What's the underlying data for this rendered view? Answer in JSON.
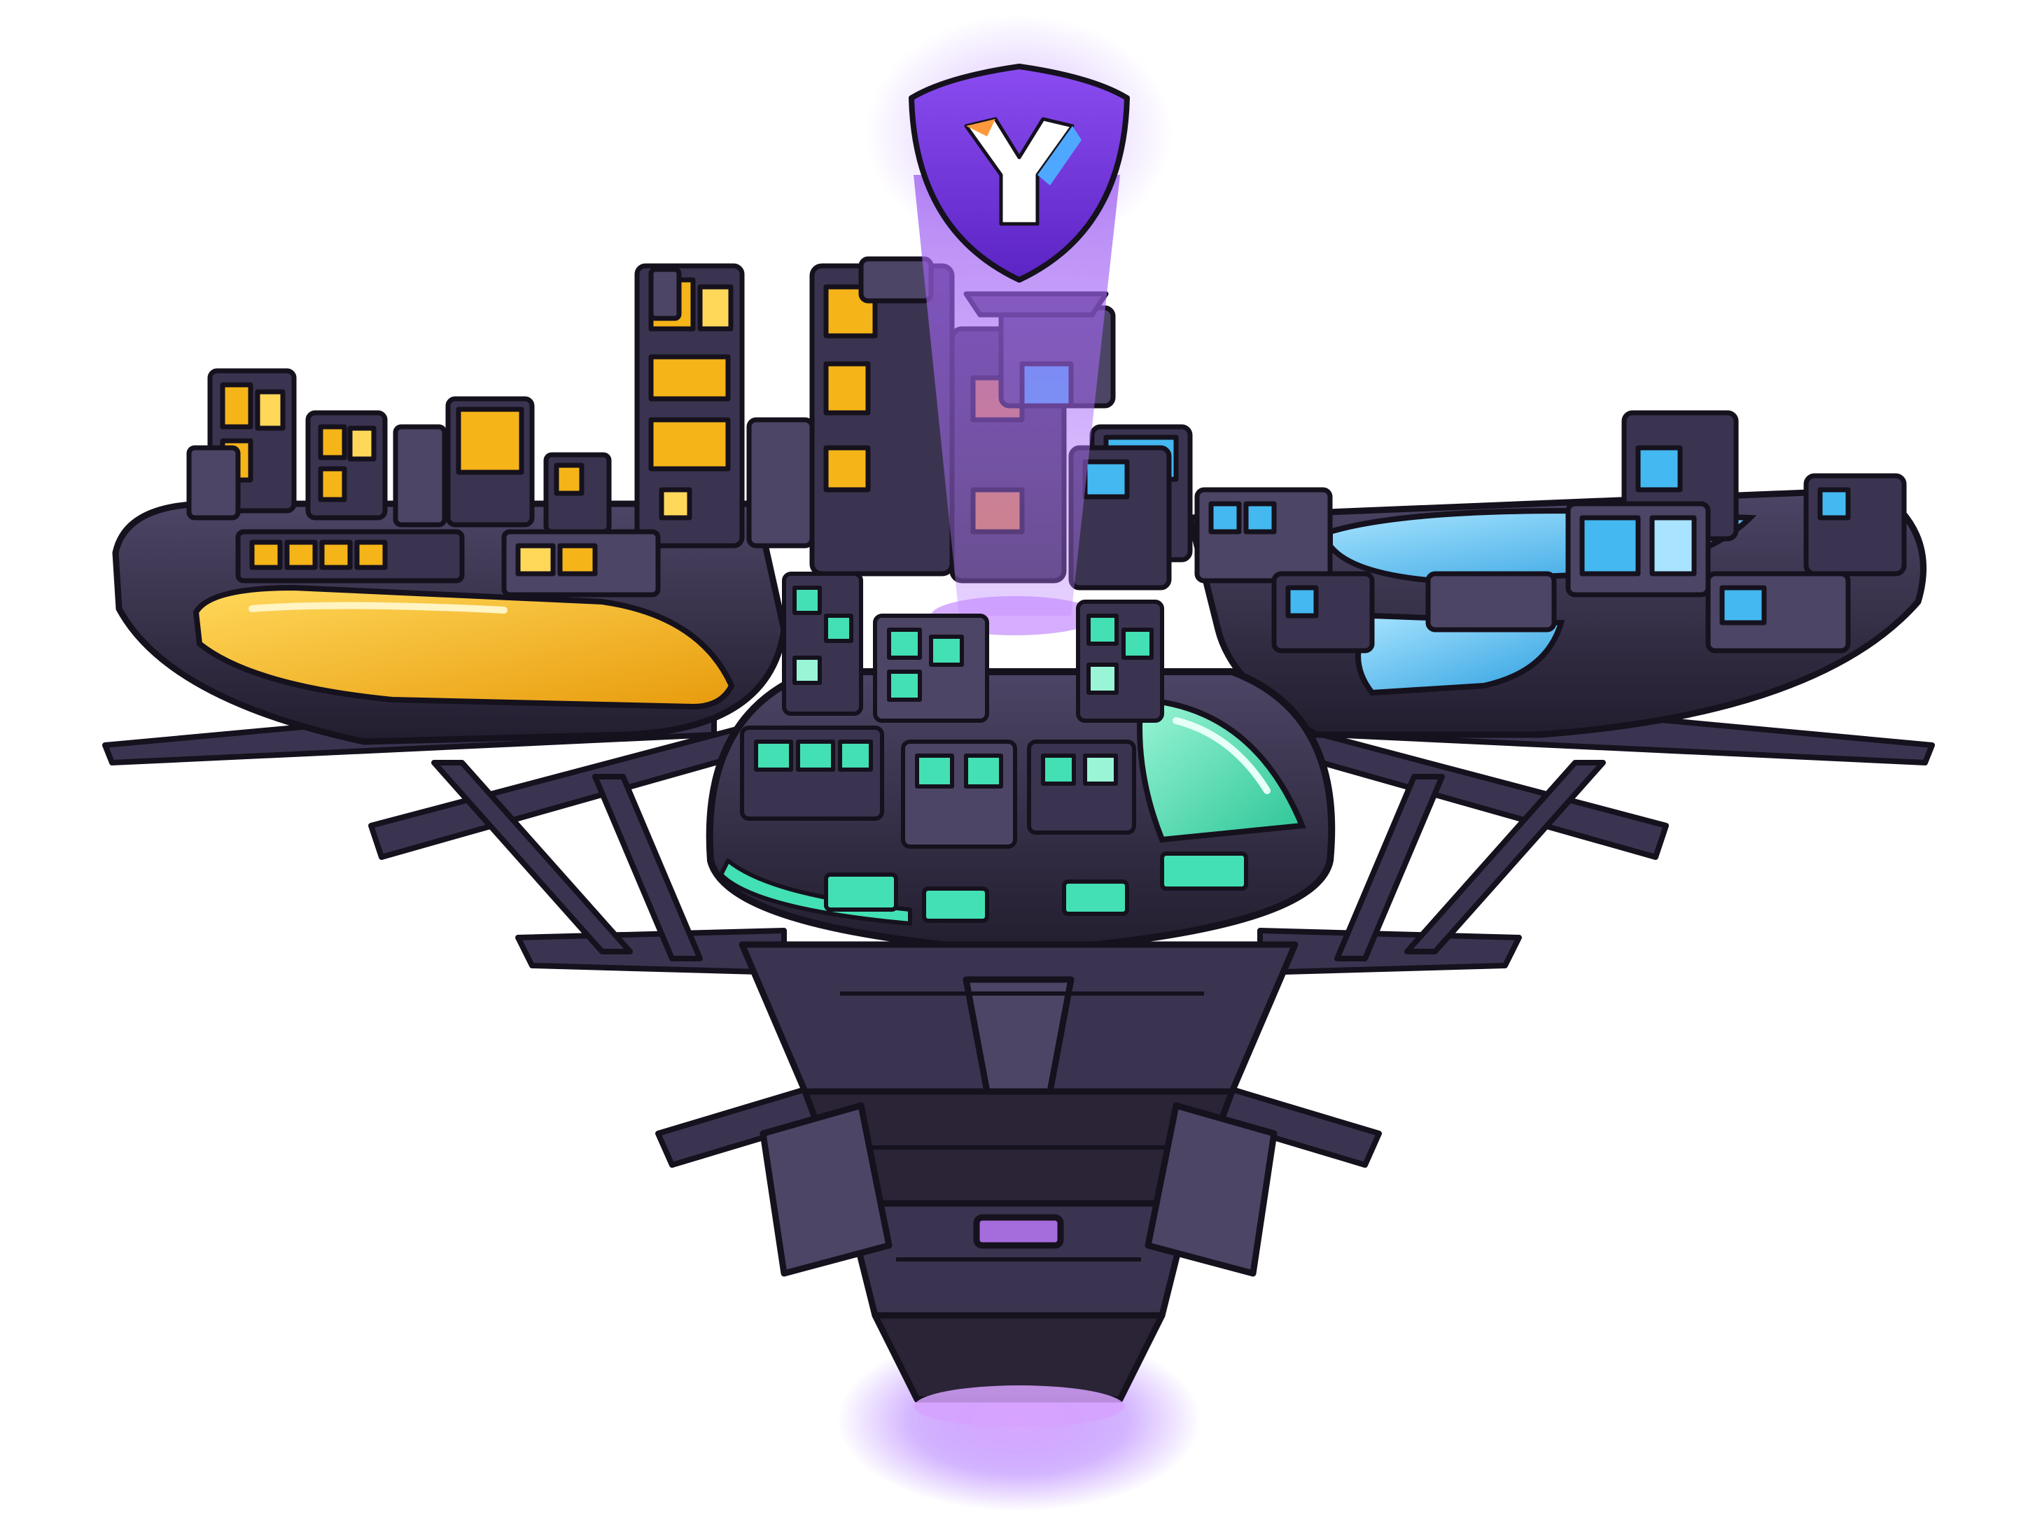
{
  "colors": {
    "background": "#ffffff",
    "hull_dark": "#2a2436",
    "hull_mid": "#3b3450",
    "hull_light": "#4d4565",
    "outline": "#15111d",
    "gold": "#f5b418",
    "gold_light": "#ffd85a",
    "teal": "#43e0b4",
    "teal_light": "#9af5d6",
    "sky": "#44b8f0",
    "sky_light": "#a8e4ff",
    "purple_beam": "#9b5cf0",
    "emblem_purple": "#7a3fe0",
    "emblem_white": "#ffffff",
    "emblem_blue": "#4fa8ff",
    "emblem_orange": "#ff9a3c",
    "engine_glow": "#c07bff"
  },
  "icons": {
    "emblem": "y-shield-emblem-icon"
  },
  "districts": [
    {
      "name": "gold-district",
      "color": "#f5b418"
    },
    {
      "name": "teal-district",
      "color": "#43e0b4"
    },
    {
      "name": "sky-district",
      "color": "#44b8f0"
    }
  ]
}
